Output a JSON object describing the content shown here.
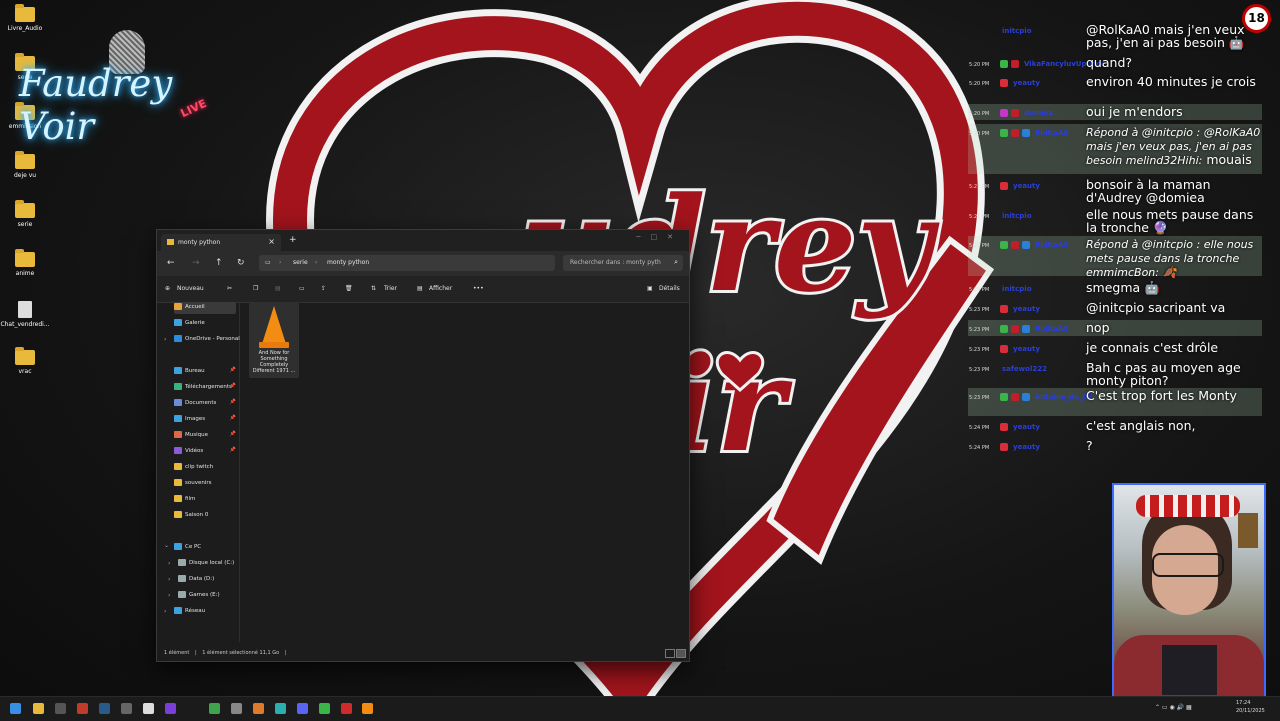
{
  "colors": {
    "heart_red": "#a3141c",
    "heart_outline": "#f5f5f5",
    "explorer_bg": "#1c1c1c",
    "webcam_border": "#3d6bff",
    "highlight_row": "#b9e1c3",
    "age_badge_red": "#c20000"
  },
  "desktop": {
    "icons": [
      {
        "label": "Livre_Audio",
        "icon": "folder-icon"
      },
      {
        "label": "serie",
        "icon": "folder-icon"
      },
      {
        "label": "emmission",
        "icon": "folder-icon"
      },
      {
        "label": "deje vu",
        "icon": "folder-icon"
      },
      {
        "label": "serie",
        "icon": "folder-icon"
      },
      {
        "label": "anime",
        "icon": "folder-icon"
      },
      {
        "label": "Chat_vendredi...",
        "icon": "file-icon"
      },
      {
        "label": "vrac",
        "icon": "folder-icon"
      }
    ]
  },
  "overlay": {
    "logo_text": "Faudrey Voir",
    "logo_badge": "LIVE",
    "age_badge": "18"
  },
  "explorer": {
    "tab_title": "monty python",
    "breadcrumb": [
      "serie",
      "monty python"
    ],
    "search_placeholder": "Rechercher dans : monty pyth",
    "toolbar": {
      "new": "Nouveau",
      "sort": "Trier",
      "view": "Afficher",
      "more": "•••",
      "details": "Détails"
    },
    "sidebar": {
      "quick": [
        {
          "label": "Accueil",
          "icon": "home-icon",
          "color": "#e8a23b"
        },
        {
          "label": "Galerie",
          "icon": "gallery-icon",
          "color": "#3fa0e0"
        },
        {
          "label": "OneDrive - Personal",
          "icon": "cloud-icon",
          "color": "#2f8be0"
        }
      ],
      "pinned": [
        {
          "label": "Bureau",
          "icon": "desktop-icon",
          "color": "#3fa0e0"
        },
        {
          "label": "Téléchargements",
          "icon": "download-icon",
          "color": "#36b37e"
        },
        {
          "label": "Documents",
          "icon": "documents-icon",
          "color": "#6b8bd6"
        },
        {
          "label": "Images",
          "icon": "images-icon",
          "color": "#3fa0e0"
        },
        {
          "label": "Musique",
          "icon": "music-icon",
          "color": "#e0674a"
        },
        {
          "label": "Vidéos",
          "icon": "video-icon",
          "color": "#8b5cd6"
        },
        {
          "label": "clip twitch",
          "icon": "folder-icon",
          "color": "#e8b93b"
        },
        {
          "label": "souvenirs",
          "icon": "folder-icon",
          "color": "#e8b93b"
        },
        {
          "label": "film",
          "icon": "folder-icon",
          "color": "#e8b93b"
        },
        {
          "label": "Saison 0",
          "icon": "folder-icon",
          "color": "#e8b93b"
        }
      ],
      "pc": {
        "label": "Ce PC",
        "icon": "pc-icon",
        "color": "#3fa0e0"
      },
      "drives": [
        {
          "label": "Disque local (C:)",
          "icon": "drive-icon",
          "color": "#9aa"
        },
        {
          "label": "Data (D:)",
          "icon": "drive-icon",
          "color": "#9aa"
        },
        {
          "label": "Games (E:)",
          "icon": "drive-icon",
          "color": "#9aa"
        }
      ],
      "network": {
        "label": "Réseau",
        "icon": "network-icon",
        "color": "#3fa0e0"
      }
    },
    "file": {
      "name": "And Now for Something Completely Different 1971 ...",
      "icon": "vlc-cone-icon"
    },
    "status": {
      "count": "1 élément",
      "selected": "1 élément sélectionné  11,1 Go"
    }
  },
  "chat": [
    {
      "time": "",
      "user": "initcpio",
      "user_color": "#2a3fd8",
      "badges": [],
      "text": "@RolKaA0 mais j'en veux pas, j'en ai pas besoin 🤖",
      "highlight": false,
      "reply": ""
    },
    {
      "time": "5:20 PM",
      "user": "VikaFancyluvUpimer",
      "user_color": "#2a3fd8",
      "badges": [
        "#3ab54a",
        "#c21d2b"
      ],
      "text": "quand?",
      "highlight": false,
      "reply": ""
    },
    {
      "time": "5:20 PM",
      "user": "yeauty",
      "user_color": "#2a3fd8",
      "badges": [
        "#d92d3a"
      ],
      "text": "environ 40 minutes je crois",
      "highlight": false,
      "reply": ""
    },
    {
      "time": "5:20 PM",
      "user": "domiea",
      "user_color": "#2a3fd8",
      "badges": [
        "#c236c8",
        "#c21d2b"
      ],
      "text": "oui je m'endors",
      "highlight": true,
      "reply": ""
    },
    {
      "time": "5:20 PM",
      "user": "RolKaA0",
      "user_color": "#2a3fd8",
      "badges": [
        "#3ab54a",
        "#c21d2b",
        "#2b7fd6"
      ],
      "text": "mouais",
      "highlight": true,
      "reply": "Répond à @initcpio : @RolKaA0 mais j'en veux pas, j'en ai pas besoin melind32Hihi:"
    },
    {
      "time": "5:21 PM",
      "user": "yeauty",
      "user_color": "#2a3fd8",
      "badges": [
        "#d92d3a"
      ],
      "text": "bonsoir à la maman d'Audrey @domiea",
      "highlight": false,
      "reply": ""
    },
    {
      "time": "5:21 PM",
      "user": "initcpio",
      "user_color": "#2a3fd8",
      "badges": [],
      "text": "elle nous mets pause dans la tronche 🔮",
      "highlight": false,
      "reply": ""
    },
    {
      "time": "5:22 PM",
      "user": "RolKaA0",
      "user_color": "#2a3fd8",
      "badges": [
        "#3ab54a",
        "#c21d2b",
        "#2b7fd6"
      ],
      "text": "",
      "highlight": true,
      "reply": "Répond à @initcpio : elle nous mets pause dans la tronche emmimcBon: 🍂"
    },
    {
      "time": "5:23 PM",
      "user": "initcpio",
      "user_color": "#2a3fd8",
      "badges": [],
      "text": "smegma 🤖",
      "highlight": false,
      "reply": ""
    },
    {
      "time": "5:23 PM",
      "user": "yeauty",
      "user_color": "#2a3fd8",
      "badges": [
        "#d92d3a"
      ],
      "text": "@initcpio sacripant va",
      "highlight": false,
      "reply": ""
    },
    {
      "time": "5:23 PM",
      "user": "RolKaA0",
      "user_color": "#2a3fd8",
      "badges": [
        "#3ab54a",
        "#c21d2b",
        "#2b7fd6"
      ],
      "text": "nop",
      "highlight": true,
      "reply": ""
    },
    {
      "time": "5:23 PM",
      "user": "yeauty",
      "user_color": "#2a3fd8",
      "badges": [
        "#d92d3a"
      ],
      "text": "je connais c'est drôle",
      "highlight": false,
      "reply": ""
    },
    {
      "time": "5:23 PM",
      "user": "safewol222",
      "user_color": "#2a3fd8",
      "badges": [],
      "text": "Bah c pas au moyen age monty piton?",
      "highlight": false,
      "reply": ""
    },
    {
      "time": "5:23 PM",
      "user": "Antoine_du_69",
      "user_color": "#2a3fd8",
      "badges": [
        "#3ab54a",
        "#c21d2b",
        "#2b7fd6"
      ],
      "text": "C'est trop fort les Monty",
      "highlight": true,
      "reply": ""
    },
    {
      "time": "5:24 PM",
      "user": "yeauty",
      "user_color": "#2a3fd8",
      "badges": [
        "#d92d3a"
      ],
      "text": "c'est anglais non,",
      "highlight": false,
      "reply": ""
    },
    {
      "time": "5:24 PM",
      "user": "yeauty",
      "user_color": "#2a3fd8",
      "badges": [
        "#d92d3a"
      ],
      "text": "?",
      "highlight": false,
      "reply": ""
    }
  ],
  "taskbar": {
    "apps": [
      {
        "name": "windows-start-icon",
        "color": "#3a8ee6"
      },
      {
        "name": "file-explorer-icon",
        "color": "#e8b93b"
      },
      {
        "name": "terminal-icon",
        "color": "#555"
      },
      {
        "name": "app-red-icon",
        "color": "#c13b2b"
      },
      {
        "name": "steam-icon",
        "color": "#2a5a8a"
      },
      {
        "name": "calculator-icon",
        "color": "#666"
      },
      {
        "name": "github-icon",
        "color": "#ddd"
      },
      {
        "name": "obs-icon",
        "color": "#7a3fd8"
      },
      {
        "name": "chrome-icon",
        "color": "#3fa34d"
      },
      {
        "name": "settings-icon",
        "color": "#888"
      },
      {
        "name": "app-orange-icon",
        "color": "#e07a2b"
      },
      {
        "name": "app-teal-icon",
        "color": "#2bb0b0"
      },
      {
        "name": "discord-icon",
        "color": "#5865f2"
      },
      {
        "name": "app-green-icon",
        "color": "#3ab54a"
      },
      {
        "name": "app-red2-icon",
        "color": "#d02b2b"
      },
      {
        "name": "vlc-icon",
        "color": "#f28c13"
      }
    ],
    "time": "17:24",
    "date": "20/11/2025"
  }
}
